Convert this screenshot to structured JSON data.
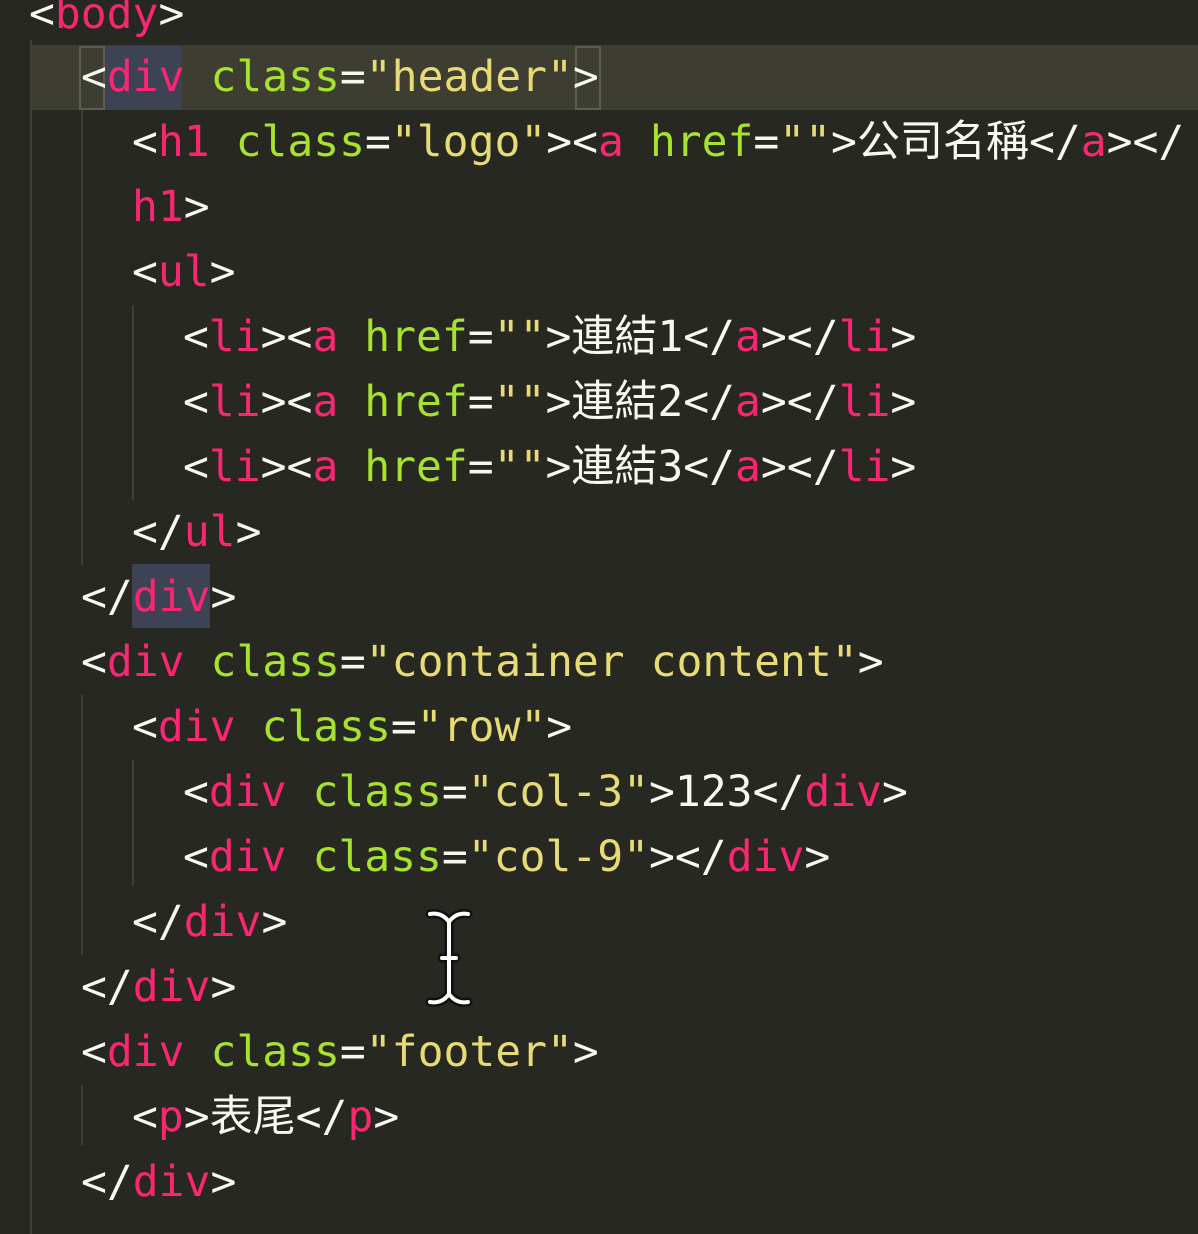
{
  "editor": {
    "lines": [
      [
        {
          "c": "p",
          "v": "<"
        },
        {
          "c": "t",
          "v": "body"
        },
        {
          "c": "p",
          "v": ">"
        }
      ],
      [
        {
          "c": "p",
          "v": "<"
        },
        {
          "c": "t",
          "v": "div"
        },
        {
          "c": "x",
          "v": " "
        },
        {
          "c": "a",
          "v": "class"
        },
        {
          "c": "p",
          "v": "="
        },
        {
          "c": "s",
          "v": "\"header\""
        },
        {
          "c": "p",
          "v": ">"
        }
      ],
      [
        {
          "c": "p",
          "v": "<"
        },
        {
          "c": "t",
          "v": "h1"
        },
        {
          "c": "x",
          "v": " "
        },
        {
          "c": "a",
          "v": "class"
        },
        {
          "c": "p",
          "v": "="
        },
        {
          "c": "s",
          "v": "\"logo\""
        },
        {
          "c": "p",
          "v": "><"
        },
        {
          "c": "t",
          "v": "a"
        },
        {
          "c": "x",
          "v": " "
        },
        {
          "c": "a",
          "v": "href"
        },
        {
          "c": "p",
          "v": "="
        },
        {
          "c": "s",
          "v": "\"\""
        },
        {
          "c": "p",
          "v": ">"
        },
        {
          "c": "x",
          "v": "公司名稱"
        },
        {
          "c": "p",
          "v": "</"
        },
        {
          "c": "t",
          "v": "a"
        },
        {
          "c": "p",
          "v": "></"
        }
      ],
      [
        {
          "c": "t",
          "v": "h1"
        },
        {
          "c": "p",
          "v": ">"
        }
      ],
      [
        {
          "c": "p",
          "v": "<"
        },
        {
          "c": "t",
          "v": "ul"
        },
        {
          "c": "p",
          "v": ">"
        }
      ],
      [
        {
          "c": "p",
          "v": "<"
        },
        {
          "c": "t",
          "v": "li"
        },
        {
          "c": "p",
          "v": "><"
        },
        {
          "c": "t",
          "v": "a"
        },
        {
          "c": "x",
          "v": " "
        },
        {
          "c": "a",
          "v": "href"
        },
        {
          "c": "p",
          "v": "="
        },
        {
          "c": "s",
          "v": "\"\""
        },
        {
          "c": "p",
          "v": ">"
        },
        {
          "c": "x",
          "v": "連結1"
        },
        {
          "c": "p",
          "v": "</"
        },
        {
          "c": "t",
          "v": "a"
        },
        {
          "c": "p",
          "v": "></"
        },
        {
          "c": "t",
          "v": "li"
        },
        {
          "c": "p",
          "v": ">"
        }
      ],
      [
        {
          "c": "p",
          "v": "<"
        },
        {
          "c": "t",
          "v": "li"
        },
        {
          "c": "p",
          "v": "><"
        },
        {
          "c": "t",
          "v": "a"
        },
        {
          "c": "x",
          "v": " "
        },
        {
          "c": "a",
          "v": "href"
        },
        {
          "c": "p",
          "v": "="
        },
        {
          "c": "s",
          "v": "\"\""
        },
        {
          "c": "p",
          "v": ">"
        },
        {
          "c": "x",
          "v": "連結2"
        },
        {
          "c": "p",
          "v": "</"
        },
        {
          "c": "t",
          "v": "a"
        },
        {
          "c": "p",
          "v": "></"
        },
        {
          "c": "t",
          "v": "li"
        },
        {
          "c": "p",
          "v": ">"
        }
      ],
      [
        {
          "c": "p",
          "v": "<"
        },
        {
          "c": "t",
          "v": "li"
        },
        {
          "c": "p",
          "v": "><"
        },
        {
          "c": "t",
          "v": "a"
        },
        {
          "c": "x",
          "v": " "
        },
        {
          "c": "a",
          "v": "href"
        },
        {
          "c": "p",
          "v": "="
        },
        {
          "c": "s",
          "v": "\"\""
        },
        {
          "c": "p",
          "v": ">"
        },
        {
          "c": "x",
          "v": "連結3"
        },
        {
          "c": "p",
          "v": "</"
        },
        {
          "c": "t",
          "v": "a"
        },
        {
          "c": "p",
          "v": "></"
        },
        {
          "c": "t",
          "v": "li"
        },
        {
          "c": "p",
          "v": ">"
        }
      ],
      [
        {
          "c": "p",
          "v": "</"
        },
        {
          "c": "t",
          "v": "ul"
        },
        {
          "c": "p",
          "v": ">"
        }
      ],
      [
        {
          "c": "p",
          "v": "</"
        },
        {
          "c": "t",
          "v": "div"
        },
        {
          "c": "p",
          "v": ">"
        }
      ],
      [
        {
          "c": "p",
          "v": "<"
        },
        {
          "c": "t",
          "v": "div"
        },
        {
          "c": "x",
          "v": " "
        },
        {
          "c": "a",
          "v": "class"
        },
        {
          "c": "p",
          "v": "="
        },
        {
          "c": "s",
          "v": "\"container content\""
        },
        {
          "c": "p",
          "v": ">"
        }
      ],
      [
        {
          "c": "p",
          "v": "<"
        },
        {
          "c": "t",
          "v": "div"
        },
        {
          "c": "x",
          "v": " "
        },
        {
          "c": "a",
          "v": "class"
        },
        {
          "c": "p",
          "v": "="
        },
        {
          "c": "s",
          "v": "\"row\""
        },
        {
          "c": "p",
          "v": ">"
        }
      ],
      [
        {
          "c": "p",
          "v": "<"
        },
        {
          "c": "t",
          "v": "div"
        },
        {
          "c": "x",
          "v": " "
        },
        {
          "c": "a",
          "v": "class"
        },
        {
          "c": "p",
          "v": "="
        },
        {
          "c": "s",
          "v": "\"col-3\""
        },
        {
          "c": "p",
          "v": ">"
        },
        {
          "c": "x",
          "v": "123"
        },
        {
          "c": "p",
          "v": "</"
        },
        {
          "c": "t",
          "v": "div"
        },
        {
          "c": "p",
          "v": ">"
        }
      ],
      [
        {
          "c": "p",
          "v": "<"
        },
        {
          "c": "t",
          "v": "div"
        },
        {
          "c": "x",
          "v": " "
        },
        {
          "c": "a",
          "v": "class"
        },
        {
          "c": "p",
          "v": "="
        },
        {
          "c": "s",
          "v": "\"col-9\""
        },
        {
          "c": "p",
          "v": "></"
        },
        {
          "c": "t",
          "v": "div"
        },
        {
          "c": "p",
          "v": ">"
        }
      ],
      [
        {
          "c": "p",
          "v": "</"
        },
        {
          "c": "t",
          "v": "div"
        },
        {
          "c": "p",
          "v": ">"
        }
      ],
      [
        {
          "c": "p",
          "v": "</"
        },
        {
          "c": "t",
          "v": "div"
        },
        {
          "c": "p",
          "v": ">"
        }
      ],
      [
        {
          "c": "p",
          "v": "<"
        },
        {
          "c": "t",
          "v": "div"
        },
        {
          "c": "x",
          "v": " "
        },
        {
          "c": "a",
          "v": "class"
        },
        {
          "c": "p",
          "v": "="
        },
        {
          "c": "s",
          "v": "\"footer\""
        },
        {
          "c": "p",
          "v": ">"
        }
      ],
      [
        {
          "c": "p",
          "v": "<"
        },
        {
          "c": "t",
          "v": "p"
        },
        {
          "c": "p",
          "v": ">"
        },
        {
          "c": "x",
          "v": "表尾"
        },
        {
          "c": "p",
          "v": "</"
        },
        {
          "c": "t",
          "v": "p"
        },
        {
          "c": "p",
          "v": ">"
        }
      ],
      [
        {
          "c": "p",
          "v": "</"
        },
        {
          "c": "t",
          "v": "div"
        },
        {
          "c": "p",
          "v": ">"
        }
      ]
    ]
  },
  "theme": {
    "background": "#272822",
    "tag_color": "#f92672",
    "attribute_color": "#a6e22e",
    "string_color": "#e6db74",
    "punctuation_color": "#f8f8f2",
    "current_line_color": "#3e3d32"
  },
  "cursor": {
    "icon": "text-cursor-icon"
  }
}
